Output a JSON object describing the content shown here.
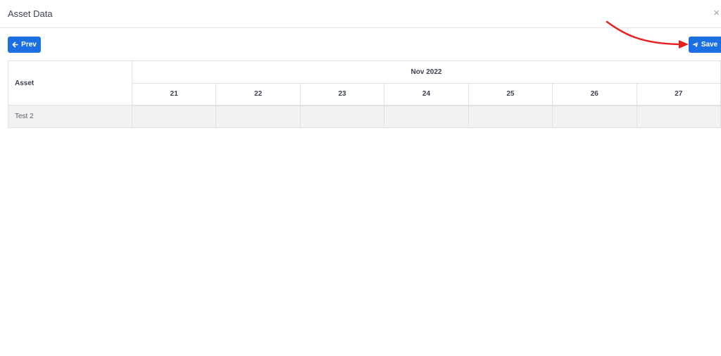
{
  "modal": {
    "title": "Asset Data",
    "close_icon": "close-icon",
    "close_glyph": "×"
  },
  "toolbar": {
    "prev_label": "Prev",
    "prev_icon": "arrow-left-icon",
    "save_label": "Save",
    "save_icon": "send-icon",
    "button_color": "#1c6fe3"
  },
  "table": {
    "asset_header": "Asset",
    "month_header": "Nov 2022",
    "days": [
      "21",
      "22",
      "23",
      "24",
      "25",
      "26",
      "27"
    ],
    "rows": [
      {
        "asset": "Test 2",
        "cells": [
          "",
          "",
          "",
          "",
          "",
          "",
          ""
        ]
      }
    ]
  },
  "annotation": {
    "color": "#e8201c",
    "points_to": "save-button"
  }
}
